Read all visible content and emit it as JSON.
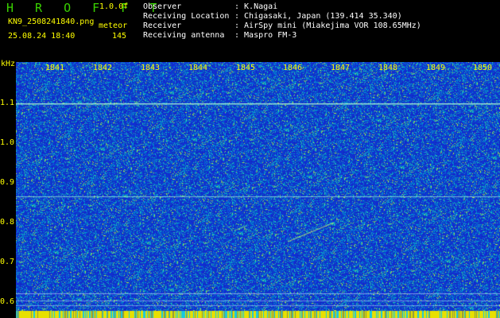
{
  "header": {
    "app_name": "H R O F F T",
    "version": "1.0.0f",
    "filename": "KN9_2508241840.png",
    "mode": "meteor",
    "datetime": "25.08.24 18:40",
    "count": "145",
    "observer_label": "Observer",
    "observer_value": ": K.Nagai",
    "location_label": "Receiving Location",
    "location_value": ": Chigasaki, Japan (139.414 35.340)",
    "receiver_label": "Receiver",
    "receiver_value": ": AirSpy mini (Miakejima VOR 108.65MHz)",
    "antenna_label": "Receiving antenna",
    "antenna_value": ": Maspro FM-3"
  },
  "axis": {
    "unit": "kHz",
    "y_ticks": [
      "1.1",
      "1.0",
      "0.9",
      "0.8",
      "0.7",
      "0.6"
    ],
    "x_ticks": [
      "1841",
      "1842",
      "1843",
      "1844",
      "1845",
      "1846",
      "1847",
      "1848",
      "1849",
      "1850"
    ]
  },
  "colors": {
    "background": "#000000",
    "waterfall_base": "#1a2fc8",
    "text_yellow": "#ffff00",
    "title_green": "#39d100",
    "carrier_line": "#9ee8d8"
  }
}
